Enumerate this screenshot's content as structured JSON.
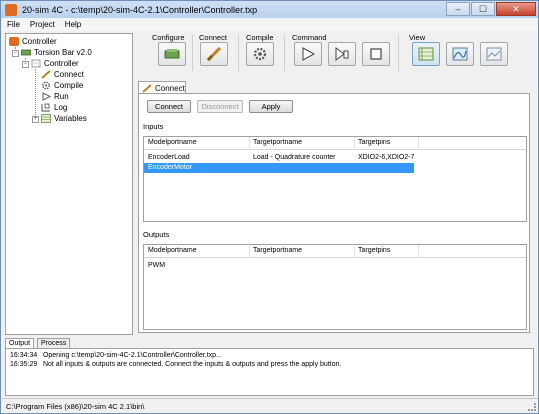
{
  "window": {
    "title": "20-sim 4C - c:\\temp\\20-sim-4C-2.1\\Controller\\Controller.txp"
  },
  "menu": [
    "File",
    "Project",
    "Help"
  ],
  "tree": {
    "root": "Controller",
    "project": "Torsion Bar v2.0",
    "node": "Controller",
    "steps": [
      "Connect",
      "Compile",
      "Run",
      "Log",
      "Variables"
    ]
  },
  "ribbon": {
    "groups": {
      "configure": "Configure",
      "connect": "Connect",
      "compile": "Compile",
      "command": "Command",
      "view": "View"
    }
  },
  "tabs": {
    "connect": "Connect"
  },
  "buttons": {
    "connect": "Connect",
    "disconnect": "Disconnect",
    "apply": "Apply"
  },
  "inputs": {
    "label": "Inputs",
    "columns": [
      "Modelportname",
      "Targetportname",
      "Targetpins"
    ],
    "rows": [
      {
        "model": "EncoderLoad",
        "target": "Load - Quadrature counter",
        "pins": "XDIO2-6,XDIO2-7"
      },
      {
        "model": "EncoderMotor",
        "target": "",
        "pins": ""
      }
    ]
  },
  "outputs": {
    "label": "Outputs",
    "columns": [
      "Modelportname",
      "Targetportname",
      "Targetpins"
    ],
    "rows": [
      {
        "model": "PWM",
        "target": "",
        "pins": ""
      }
    ]
  },
  "bottom_tabs": [
    "Output",
    "Process"
  ],
  "log": [
    {
      "time": "16:34:34",
      "text": "Opening c:\\temp\\20-sim-4C-2.1\\Controller\\Controller.txp..."
    },
    {
      "time": "16:35:29",
      "text": "Not all inputs & outputs are connected. Connect the inputs & outputs and press the apply button."
    }
  ],
  "status": "C:\\Program Files (x86)\\20-sim 4C 2.1\\bin\\",
  "colors": {
    "selection": "#3399ff",
    "title_gradient": "#cfe0f3",
    "app_icon": "#e26b1e"
  },
  "icons": [
    "app-icon",
    "configure-icon",
    "connect-icon",
    "compile-icon",
    "run-icon",
    "step-icon",
    "stop-icon",
    "view-panel-icon",
    "view-plot-icon",
    "view-monitor-icon"
  ]
}
